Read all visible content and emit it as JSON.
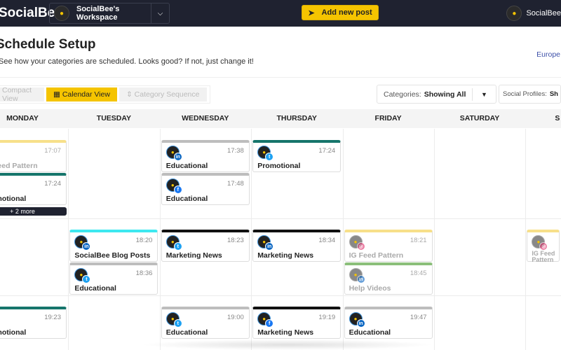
{
  "app": {
    "logo": "SocialBee",
    "workspace": "SocialBee's Workspace",
    "add_post": "Add new post",
    "user": "SocialBee"
  },
  "page": {
    "title": "Schedule Setup",
    "subtitle": "See how your categories are scheduled. Looks good? If not, just change it!",
    "timezone": "Europe"
  },
  "views": {
    "compact": "Compact View",
    "calendar": "Calendar View",
    "sequence": "Category Sequence",
    "active": "calendar"
  },
  "filters": {
    "categories_label": "Categories:",
    "categories_value": "Showing All",
    "profiles_label": "Social Profiles:",
    "profiles_value": "Sh"
  },
  "days": [
    "MONDAY",
    "TUESDAY",
    "WEDNESDAY",
    "THURSDAY",
    "FRIDAY",
    "SATURDAY",
    "S"
  ],
  "colors": {
    "topbar": "#1f2230",
    "accent": "#f5c400",
    "linkedin": "#0a66c2",
    "twitter": "#1da1f2",
    "facebook": "#1877f2",
    "instagram": "#e1306c"
  },
  "rows": [
    {
      "cells": [
        [
          {
            "time": "17:07",
            "label": "IG Feed Pattern",
            "network": "instagram",
            "color": "#f7e08a",
            "faded": true
          },
          {
            "time": "17:24",
            "label": "Promotional",
            "network": "twitter",
            "color": "#16756b"
          }
        ],
        [],
        [
          {
            "time": "17:38",
            "label": "Educational",
            "network": "linkedin",
            "color": "#bdbdbd"
          },
          {
            "time": "17:48",
            "label": "Educational",
            "network": "facebook",
            "color": "#bdbdbd"
          }
        ],
        [
          {
            "time": "17:24",
            "label": "Promotional",
            "network": "twitter",
            "color": "#16756b"
          }
        ],
        [],
        [],
        []
      ],
      "more": {
        "day": 0,
        "label": "+ 2 more"
      }
    },
    {
      "cells": [
        [],
        [
          {
            "time": "18:20",
            "label": "SocialBee Blog Posts",
            "network": "linkedin",
            "color": "#3ee8f0"
          },
          {
            "time": "18:36",
            "label": "Educational",
            "network": "twitter",
            "color": "#bdbdbd"
          }
        ],
        [
          {
            "time": "18:23",
            "label": "Marketing News",
            "network": "twitter",
            "color": "#111111"
          }
        ],
        [
          {
            "time": "18:34",
            "label": "Marketing News",
            "network": "linkedin",
            "color": "#111111"
          }
        ],
        [
          {
            "time": "18:21",
            "label": "IG Feed Pattern",
            "network": "instagram",
            "color": "#f7e08a",
            "faded": true
          },
          {
            "time": "18:45",
            "label": "Help Videos",
            "network": "linkedin",
            "color": "#8bbf7a",
            "faded": true
          }
        ],
        [],
        [
          {
            "time": "",
            "label": "IG Feed Pattern",
            "network": "instagram",
            "color": "#f7e08a",
            "faded": true
          }
        ]
      ]
    },
    {
      "cells": [
        [
          {
            "time": "19:23",
            "label": "Promotional",
            "network": "twitter",
            "color": "#16756b"
          }
        ],
        [],
        [
          {
            "time": "19:00",
            "label": "Educational",
            "network": "twitter",
            "color": "#bdbdbd"
          }
        ],
        [
          {
            "time": "19:19",
            "label": "Marketing News",
            "network": "facebook",
            "color": "#111111"
          }
        ],
        [
          {
            "time": "19:47",
            "label": "Educational",
            "network": "linkedin",
            "color": "#bdbdbd"
          }
        ],
        [],
        []
      ]
    }
  ]
}
